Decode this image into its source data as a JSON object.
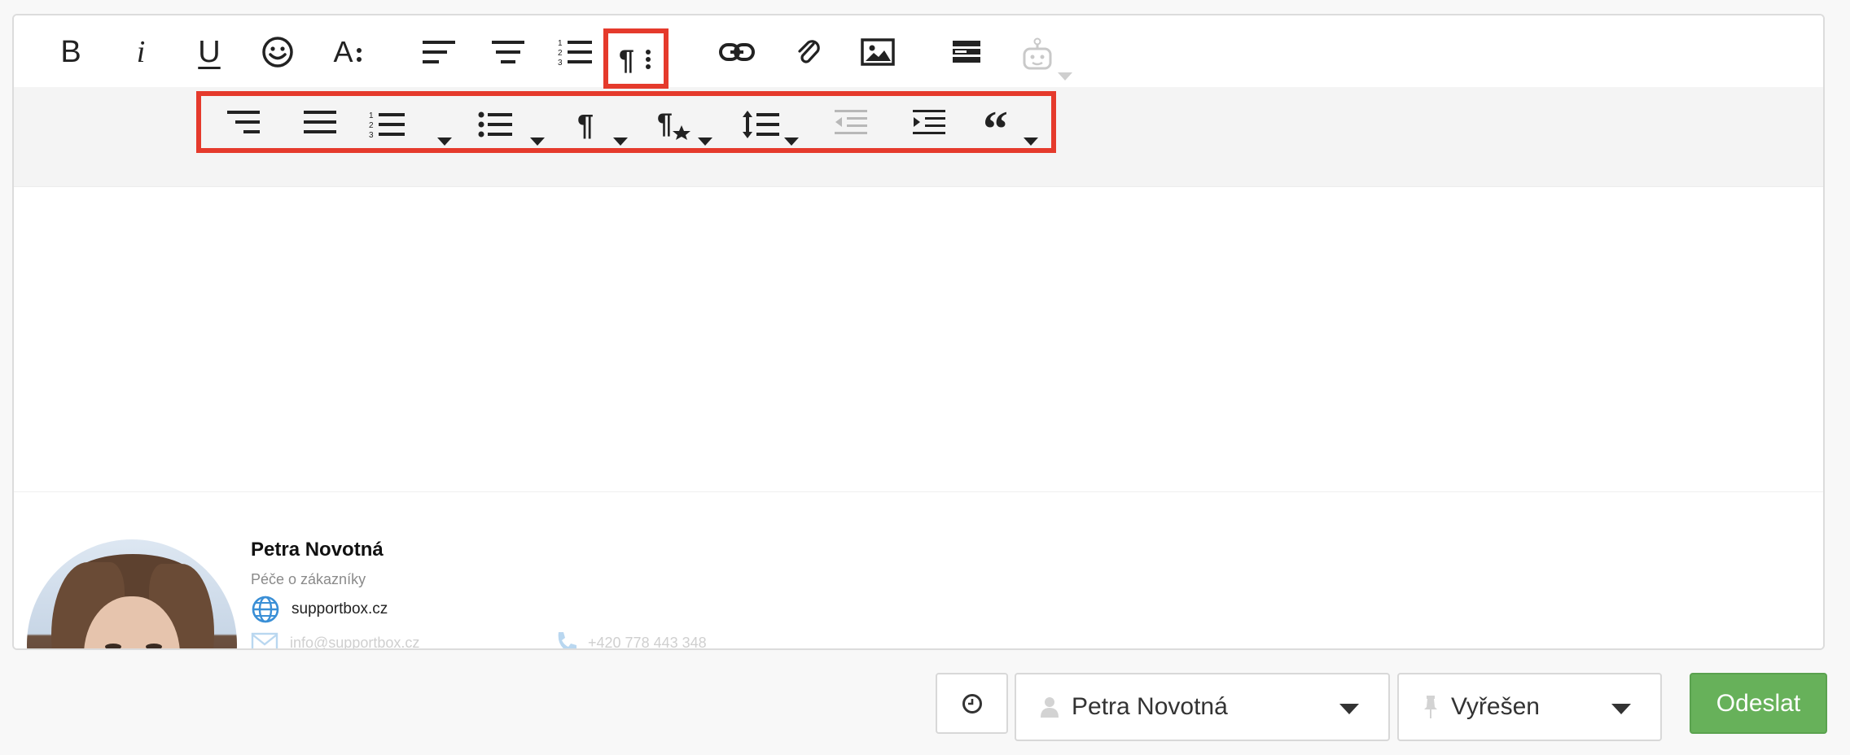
{
  "toolbar_top": {
    "bold_label": "B",
    "italic_label": "i",
    "underline_label": "U",
    "font_size_label": "A",
    "icons": [
      "bold-icon",
      "italic-icon",
      "underline-icon",
      "emoji-icon",
      "font-size-icon",
      "align-left-icon",
      "align-center-icon",
      "ordered-list-icon",
      "paragraph-more-icon",
      "link-icon",
      "attachment-icon",
      "image-icon",
      "template-icon",
      "bot-icon"
    ]
  },
  "toolbar_paragraph": {
    "icons": [
      "align-right-icon",
      "justify-icon",
      "ordered-list-icon",
      "unordered-list-icon",
      "paragraph-format-icon",
      "paragraph-style-icon",
      "line-height-icon",
      "outdent-icon",
      "indent-icon",
      "quote-icon"
    ]
  },
  "signature": {
    "name": "Petra Novotná",
    "role": "Péče o zákazníky",
    "website": "supportbox.cz",
    "email": "info@supportbox.cz",
    "phone": "+420 778 443 348"
  },
  "footer": {
    "assignee": "Petra Novotná",
    "status": "Vyřešen",
    "send_label": "Odeslat"
  },
  "colors": {
    "highlight": "#e53a2c",
    "send_button": "#67b15a",
    "globe_icon": "#3a8fd6"
  }
}
